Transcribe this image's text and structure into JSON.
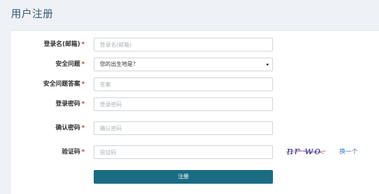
{
  "page": {
    "title": "用户注册"
  },
  "form": {
    "required_mark": "*",
    "username": {
      "label": "登录名(邮箱)",
      "placeholder": "登录名(邮箱)",
      "value": ""
    },
    "security_question": {
      "label": "安全问题",
      "selected": "您的出生地是？"
    },
    "security_answer": {
      "label": "安全问题答案",
      "placeholder": "答案",
      "value": ""
    },
    "password": {
      "label": "登录密码",
      "placeholder": "登录密码",
      "value": ""
    },
    "confirm_password": {
      "label": "确认密码",
      "placeholder": "确认密码",
      "value": ""
    },
    "captcha": {
      "label": "验证码",
      "placeholder": "验证码",
      "value": "",
      "image_text": "nr wo",
      "refresh_label": "换一个"
    },
    "submit_label": "注册"
  },
  "colors": {
    "title": "#3a5a79",
    "required": "#d9372c",
    "submit_bg": "#1a6c82",
    "link": "#3a7fc1"
  }
}
